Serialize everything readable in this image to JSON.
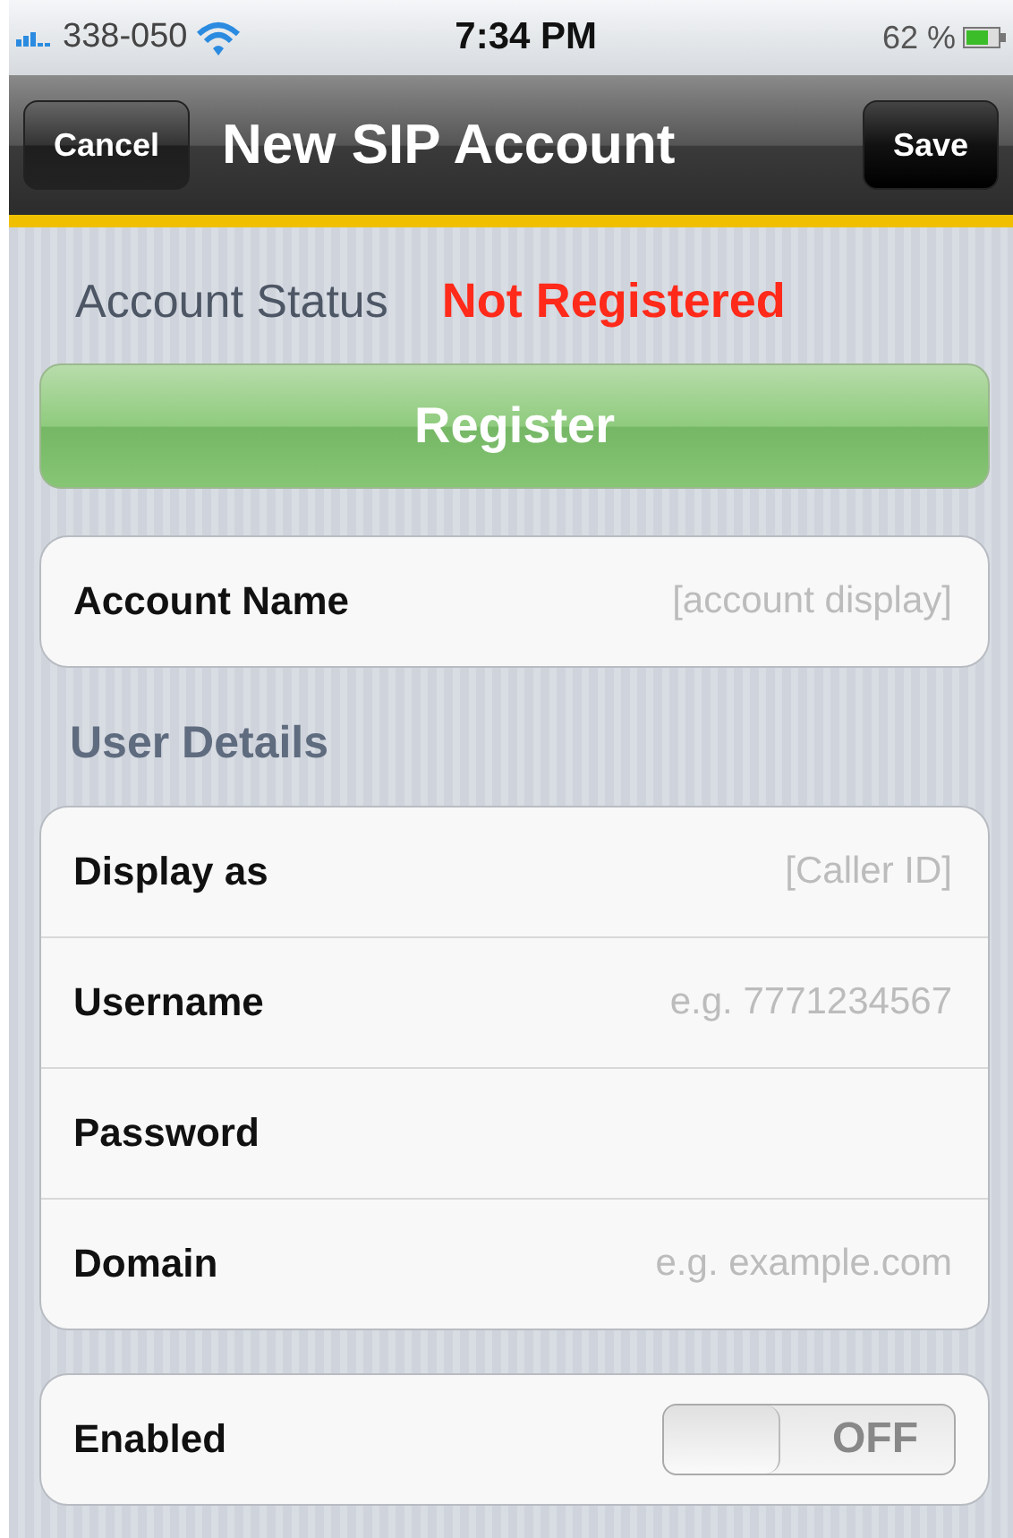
{
  "status_bar": {
    "carrier": "338-050",
    "time": "7:34 PM",
    "battery": "62 %"
  },
  "nav_bar": {
    "title": "New SIP Account",
    "left_button": "Cancel",
    "right_button": "Save"
  },
  "account_status": {
    "label": "Account Status",
    "value": "Not Registered",
    "registered": false
  },
  "register_button": "Register",
  "account_group": [
    {
      "label": "Account Name",
      "placeholder": "[account display]"
    }
  ],
  "user_details": {
    "header": "User Details",
    "fields": [
      {
        "label": "Display as",
        "placeholder": "[Caller ID]"
      },
      {
        "label": "Username",
        "placeholder": "e.g. 7771234567"
      },
      {
        "label": "Password"
      },
      {
        "label": "Domain",
        "placeholder": "e.g. example.com"
      }
    ]
  },
  "settings": [
    {
      "kind": "switch",
      "label": "Enabled",
      "on": false,
      "state_text": "OFF"
    }
  ]
}
